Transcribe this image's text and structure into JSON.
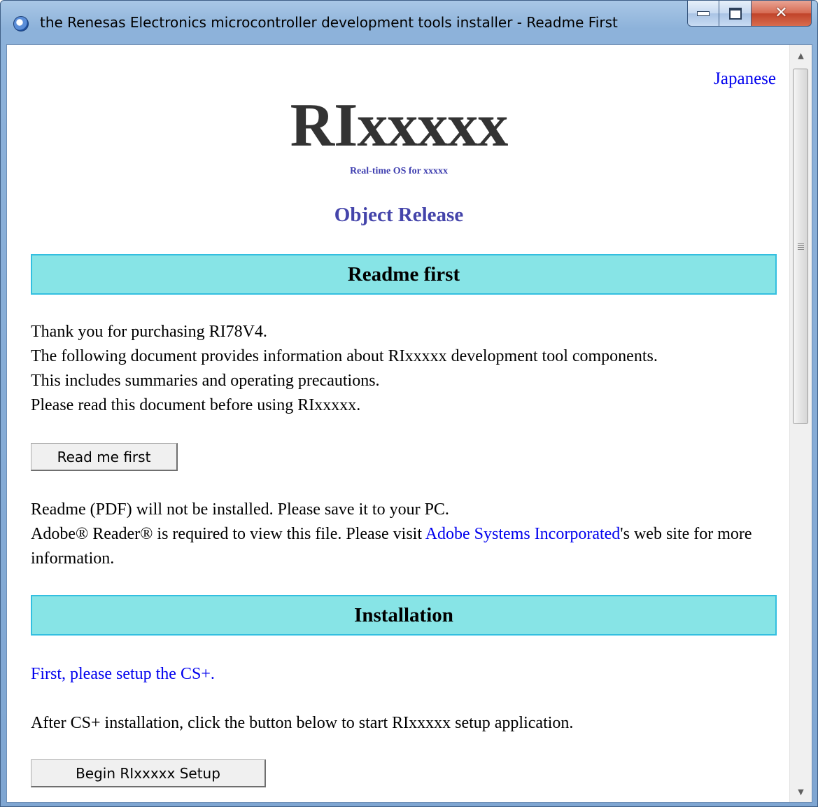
{
  "window": {
    "title": "the Renesas Electronics microcontroller development tools installer - Readme First",
    "icon": "globe-icon",
    "buttons": {
      "minimize": "minimize-icon",
      "maximize": "maximize-icon",
      "close": "✕"
    }
  },
  "header": {
    "language_link": "Japanese",
    "logo": "RIxxxxx",
    "logo_subtitle": "Real-time OS for xxxxx",
    "release": "Object Release"
  },
  "readme": {
    "heading": "Readme first",
    "lines": [
      "Thank you for purchasing RI78V4.",
      "The following document provides information about RIxxxxx development tool components.",
      "This includes summaries and operating precautions.",
      "Please read this document before using RIxxxxx."
    ],
    "button_label": "Read me first",
    "note_line1": "Readme (PDF) will not be installed. Please save it to your PC.",
    "note_line2_prefix": "Adobe® Reader® is required to view this file. Please visit ",
    "note_link": "Adobe Systems Incorporated",
    "note_line2_suffix": "'s web site for more information."
  },
  "installation": {
    "heading": "Installation",
    "first_link": "First, please setup the CS+.",
    "instruction": "After CS+ installation, click the button below to start RIxxxxx setup application.",
    "button_label": "Begin RIxxxxx Setup"
  },
  "scrollbar": {
    "position_fraction": 0.0,
    "visible_fraction": 0.46
  },
  "colors": {
    "section_bg": "#87e4e6",
    "section_border": "#33bfe0",
    "link": "#0000ee",
    "release_text": "#4444aa",
    "logo_text": "#333333"
  }
}
